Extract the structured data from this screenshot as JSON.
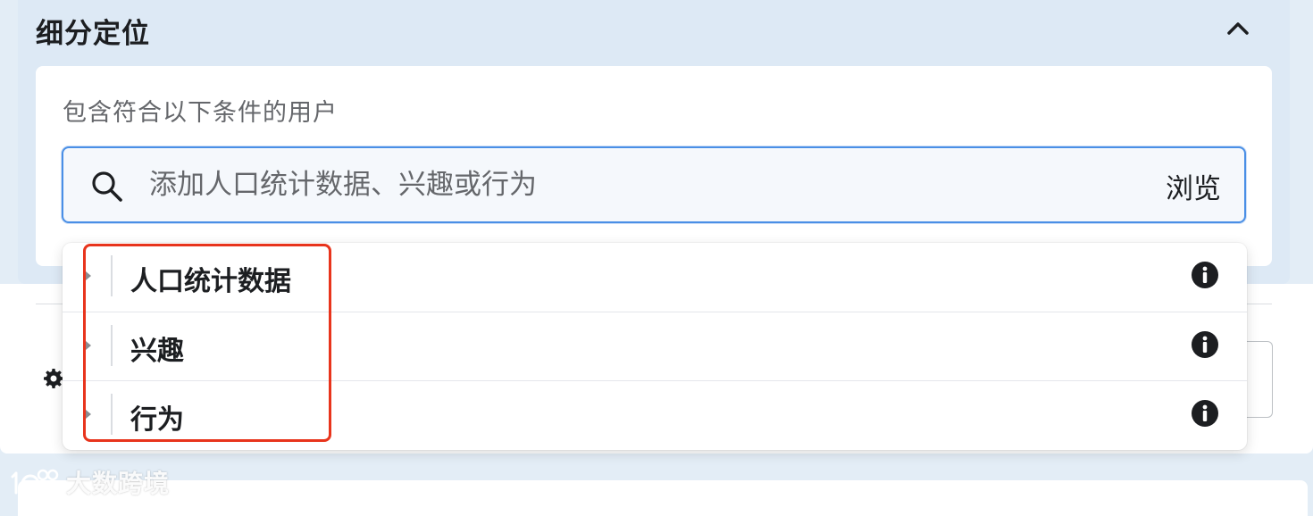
{
  "section": {
    "title": "细分定位",
    "include_label": "包含符合以下条件的用户"
  },
  "search": {
    "placeholder": "添加人口统计数据、兴趣或行为",
    "browse_label": "浏览"
  },
  "dropdown": {
    "items": [
      {
        "label": "人口统计数据"
      },
      {
        "label": "兴趣"
      },
      {
        "label": "行为"
      }
    ]
  },
  "watermark": {
    "text": "大数跨境"
  },
  "colors": {
    "accent": "#4a8fe6",
    "highlight": "#e8341c",
    "panel": "#dde9f5"
  },
  "icons": {
    "collapse": "chevron-up-icon",
    "search": "search-icon",
    "info": "info-icon",
    "settings": "gear-icon"
  }
}
